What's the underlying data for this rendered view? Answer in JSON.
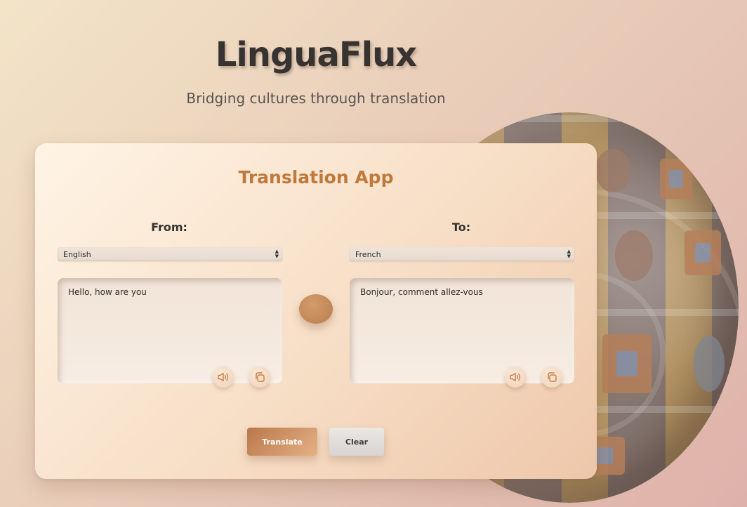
{
  "app": {
    "brand": "LinguaFlux",
    "tagline": "Bridging cultures through translation"
  },
  "card": {
    "title": "Translation App",
    "from_label": "From:",
    "to_label": "To:",
    "from_language": "English",
    "to_language": "French",
    "source_text": "Hello, how are you",
    "translated_text": "Bonjour, comment allez-vous"
  },
  "buttons": {
    "translate": "Translate",
    "clear": "Clear"
  },
  "icons": {
    "speaker": "speaker-icon",
    "copy": "copy-icon",
    "swap": "swap-icon"
  },
  "colors": {
    "accent": "#c0793c",
    "translate_button": "#c98a5a",
    "clear_button": "#e0dbd8"
  }
}
